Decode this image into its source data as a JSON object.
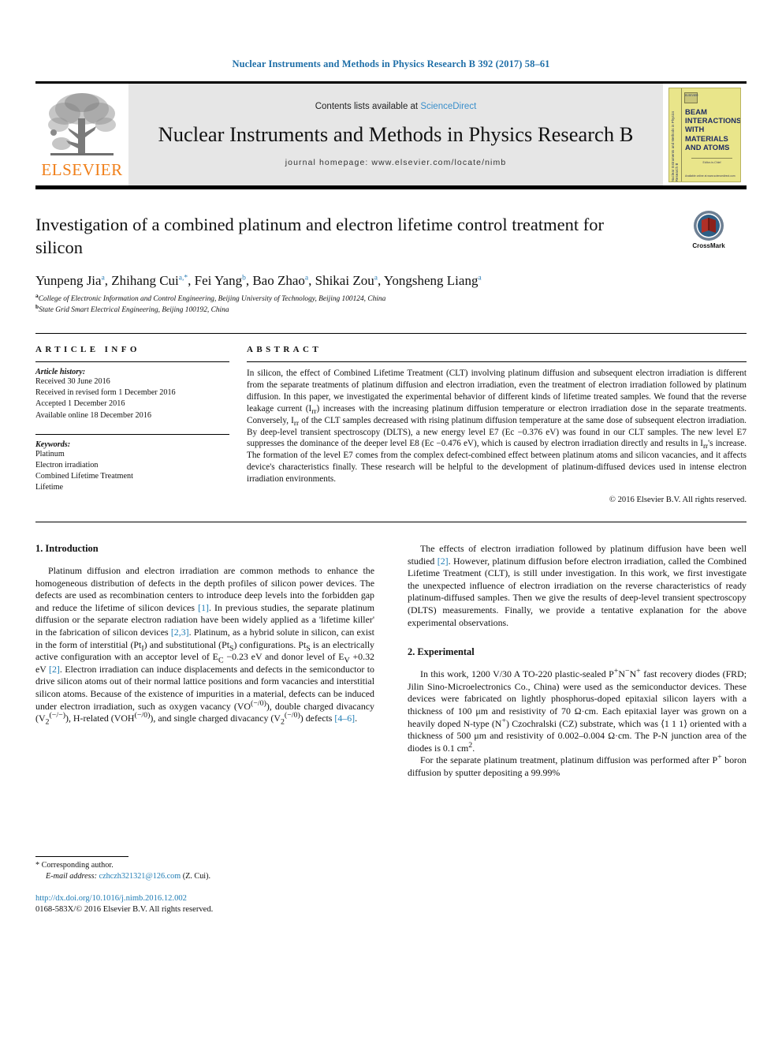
{
  "running_head": "Nuclear Instruments and Methods in Physics Research B 392 (2017) 58–61",
  "masthead": {
    "publisher_wordmark": "ELSEVIER",
    "contents_prefix": "Contents lists available at ",
    "contents_link": "ScienceDirect",
    "journal_title": "Nuclear Instruments and Methods in Physics Research B",
    "homepage": "journal homepage: www.elsevier.com/locate/nimb",
    "cover": {
      "title_lines": [
        "BEAM",
        "INTERACTIONS",
        "WITH",
        "MATERIALS",
        "AND ATOMS"
      ],
      "spine_text": "Nuclear Instruments and Methods in Physics Research B",
      "mini_logo": "ELSEVIER",
      "mid_text": "Editor-in-Chief",
      "foot_text": "Available online at www.sciencedirect.com"
    }
  },
  "article": {
    "title": "Investigation of a combined platinum and electron lifetime control treatment for silicon",
    "crossmark_label": "CrossMark",
    "authors": [
      {
        "name": "Yunpeng Jia",
        "marks": "a"
      },
      {
        "name": "Zhihang Cui",
        "marks": "a,*"
      },
      {
        "name": "Fei Yang",
        "marks": "b"
      },
      {
        "name": "Bao Zhao",
        "marks": "a"
      },
      {
        "name": "Shikai Zou",
        "marks": "a"
      },
      {
        "name": "Yongsheng Liang",
        "marks": "a"
      }
    ],
    "affiliations": [
      {
        "mark": "a",
        "text": "College of Electronic Information and Control Engineering, Beijing University of Technology, Beijing 100124, China"
      },
      {
        "mark": "b",
        "text": "State Grid Smart Electrical Engineering, Beijing 100192, China"
      }
    ]
  },
  "article_info": {
    "heading": "ARTICLE INFO",
    "history_label": "Article history:",
    "history": [
      "Received 30 June 2016",
      "Received in revised form 1 December 2016",
      "Accepted 1 December 2016",
      "Available online 18 December 2016"
    ],
    "keywords_label": "Keywords:",
    "keywords": [
      "Platinum",
      "Electron irradiation",
      "Combined Lifetime Treatment",
      "Lifetime"
    ]
  },
  "abstract": {
    "heading": "ABSTRACT",
    "text": "In silicon, the effect of Combined Lifetime Treatment (CLT) involving platinum diffusion and subsequent electron irradiation is different from the separate treatments of platinum diffusion and electron irradiation, even the treatment of electron irradiation followed by platinum diffusion. In this paper, we investigated the experimental behavior of different kinds of lifetime treated samples. We found that the reverse leakage current (Irr) increases with the increasing platinum diffusion temperature or electron irradiation dose in the separate treatments. Conversely, Irr of the CLT samples decreased with rising platinum diffusion temperature at the same dose of subsequent electron irradiation. By deep-level transient spectroscopy (DLTS), a new energy level E7 (Ec −0.376 eV) was found in our CLT samples. The new level E7 suppresses the dominance of the deeper level E8 (Ec −0.476 eV), which is caused by electron irradiation directly and results in Irr's increase. The formation of the level E7 comes from the complex defect-combined effect between platinum atoms and silicon vacancies, and it affects device's characteristics finally. These research will be helpful to the development of platinum-diffused devices used in intense electron irradiation environments.",
    "copyright": "© 2016 Elsevier B.V. All rights reserved."
  },
  "sections": {
    "introduction": {
      "heading": "1. Introduction",
      "paragraph_1_a": "Platinum diffusion and electron irradiation are common methods to enhance the homogeneous distribution of defects in the depth profiles of silicon power devices. The defects are used as recombination centers to introduce deep levels into the forbidden gap and reduce the lifetime of silicon devices ",
      "cite_1": "[1]",
      "paragraph_1_b": ". In previous studies, the separate platinum diffusion or the separate electron radiation have been widely applied as a 'lifetime killer' in the fabrication of silicon devices ",
      "cite_2_3": "[2,3]",
      "paragraph_1_c": ". Platinum, as a hybrid solute in silicon, can exist in the form of interstitial (PtI) and substitutional (PtS) configurations. PtS is an electrically active configuration with an acceptor level of EC −0.23 eV and donor level of EV +0.32 eV ",
      "cite_2": "[2]",
      "paragraph_1_d": ". Electron irradiation can induce displacements and defects in the semiconductor to drive silicon atoms out of their normal lattice positions and form vacancies and interstitial silicon atoms. Because of the existence of impurities in a material, defects can be induced under electron irradiation, such as oxygen vacancy (VO(−/0)), double charged divacancy (V2(−/−)), H-related (VOH(−/0)), and single charged divacancy (V2(−/0)) defects ",
      "cite_4_6": "[4–6]",
      "paragraph_1_e": ".",
      "paragraph_2_a": "The effects of electron irradiation followed by platinum diffusion have been well studied ",
      "paragraph_2_b": ". However, platinum diffusion before electron irradiation, called the Combined Lifetime Treatment (CLT), is still under investigation. In this work, we first investigate the unexpected influence of electron irradiation on the reverse characteristics of ready platinum-diffused samples. Then we give the results of deep-level transient spectroscopy (DLTS) measurements. Finally, we provide a tentative explanation for the above experimental observations."
    },
    "experimental": {
      "heading": "2. Experimental",
      "paragraph_1_a": "In this work, 1200 V/30 A TO-220 plastic-sealed P",
      "paragraph_1_b": " fast recovery diodes (FRD; Jilin Sino-Microelectronics Co., China) were used as the semiconductor devices. These devices were fabricated on lightly phosphorus-doped epitaxial silicon layers with a thickness of 100 μm and resistivity of 70 Ω·cm. Each epitaxial layer was grown on a heavily doped N-type (N",
      "paragraph_1_c": ") Czochralski (CZ) substrate, which was ⟨1 1 1⟩ oriented with a thickness of 500 μm and resistivity of 0.002–0.004 Ω·cm. The P-N junction area of the diodes is 0.1 cm",
      "paragraph_1_d": ".",
      "paragraph_2_a": "For the separate platinum treatment, platinum diffusion was performed after P",
      "paragraph_2_b": " boron diffusion by sputter depositing a 99.99%"
    }
  },
  "footnote": {
    "corresponding_marker": "*",
    "corresponding_text": "Corresponding author.",
    "email_label": "E-mail address:",
    "email": "czhczh321321@126.com",
    "email_suffix": "(Z. Cui)."
  },
  "footer": {
    "doi": "http://dx.doi.org/10.1016/j.nimb.2016.12.002",
    "issn_line": "0168-583X/© 2016 Elsevier B.V. All rights reserved."
  },
  "colors": {
    "link_blue": "#1f7cb4",
    "running_head_blue": "#1f6fa8",
    "elsevier_orange": "#f07f19",
    "band_grey": "#e6e6e6",
    "cover_yellow": "#e9e58a",
    "cover_navy": "#1d2a63"
  }
}
